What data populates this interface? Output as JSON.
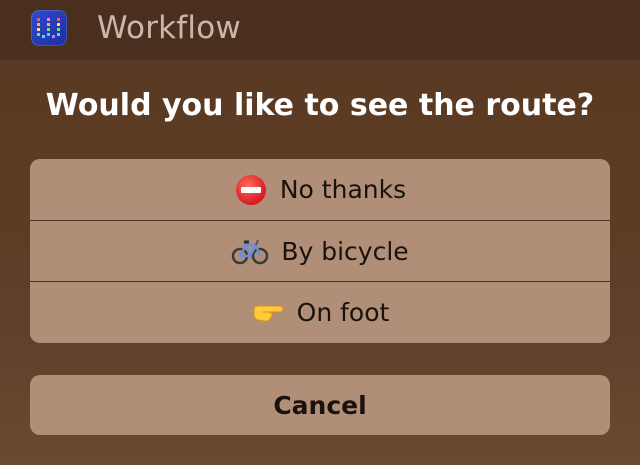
{
  "header": {
    "app_title": "Workflow",
    "icon": "workflow-app-icon"
  },
  "dialog": {
    "question": "Would you like to see the route?",
    "options": [
      {
        "label": "No thanks",
        "icon": "no-entry-icon"
      },
      {
        "label": "By bicycle",
        "icon": "bicycle-icon"
      },
      {
        "label": "On foot",
        "icon": "pointing-hand-icon"
      }
    ],
    "cancel_label": "Cancel"
  },
  "colors": {
    "background": "#5c3b24",
    "header": "#4a2f1f",
    "button": "#b08e77",
    "separator": "#4a3023"
  }
}
